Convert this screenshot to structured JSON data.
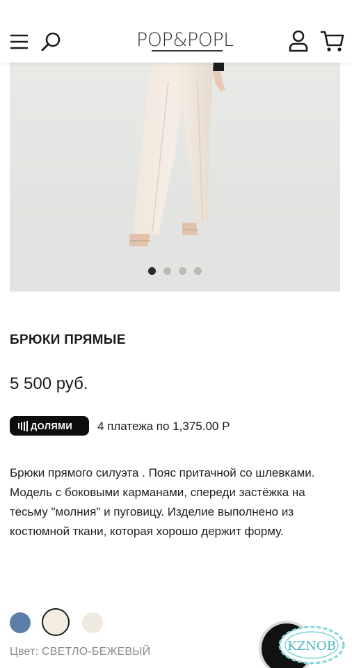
{
  "header": {
    "logo_text": "POP&POPL",
    "icons": [
      "menu-icon",
      "search-icon",
      "user-icon",
      "cart-icon"
    ]
  },
  "gallery": {
    "slide_count": 4,
    "active_slide": 1
  },
  "product": {
    "title": "БРЮКИ ПРЯМЫЕ",
    "price": "5 500 руб.",
    "dolyami_label": "ДОЛЯМИ",
    "installment_text": "4 платежа по 1,375.00 Р",
    "description": "Брюки прямого силуэта . Пояс притачной со шлевками. Модель с боковыми карманами, спереди застёжка на тесьму \"молния\" и пуговицу. Изделие выполнено из костюмной ткани, которая хорошо держит форму.",
    "colors": [
      {
        "hex": "#5b7fa6",
        "selected": false
      },
      {
        "hex": "#f3ece2",
        "selected": true
      },
      {
        "hex": "#efe9e1",
        "selected": false
      }
    ],
    "color_label": "Цвет: СВЕТЛО-БЕЖЕВЫЙ"
  },
  "watermark": {
    "text": "KZNOB"
  },
  "theme": {
    "accent": "#0d0d0d",
    "text_muted": "#8a8a8a",
    "photo_bg": "#e8e9e6"
  }
}
